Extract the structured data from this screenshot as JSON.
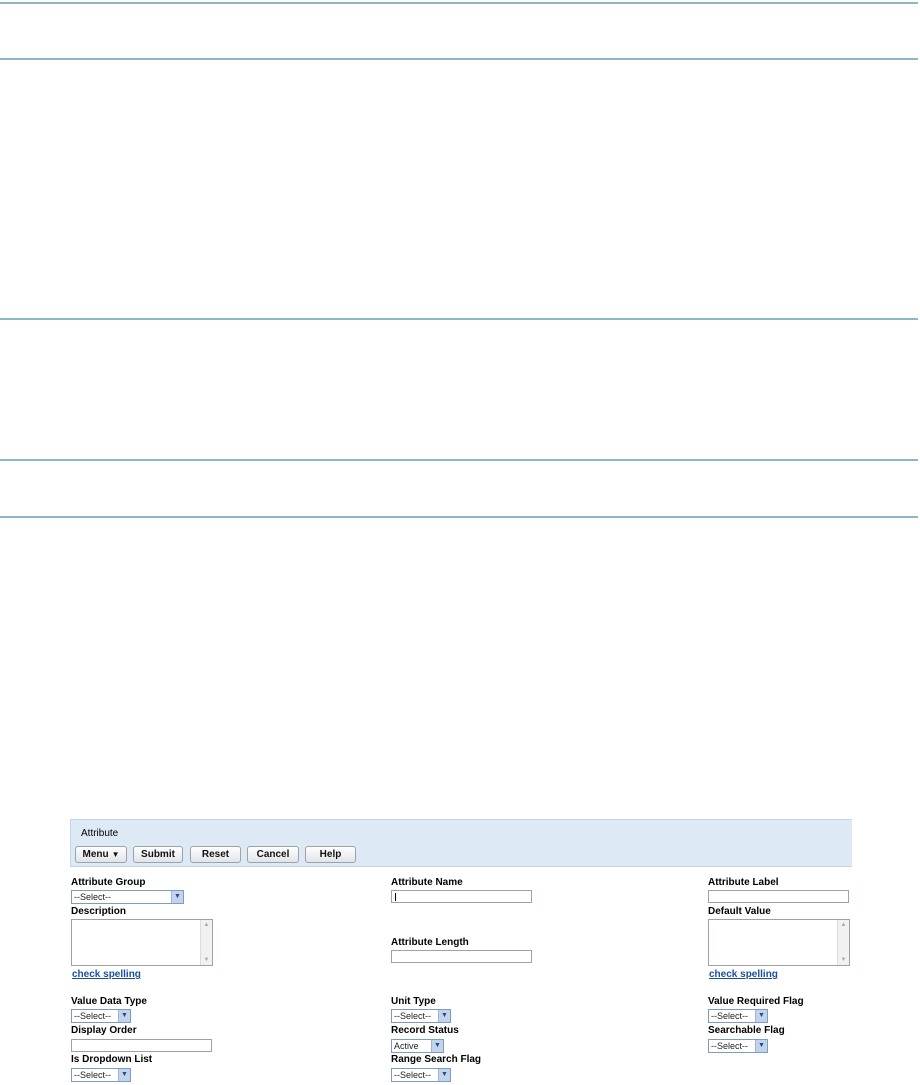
{
  "header": {
    "title": "Attribute"
  },
  "toolbar": {
    "menu_label": "Menu",
    "submit_label": "Submit",
    "reset_label": "Reset",
    "cancel_label": "Cancel",
    "help_label": "Help"
  },
  "fields": {
    "attribute_group": {
      "label": "Attribute Group",
      "value": "--Select--"
    },
    "attribute_name": {
      "label": "Attribute Name",
      "value": ""
    },
    "attribute_label": {
      "label": "Attribute Label",
      "value": ""
    },
    "description": {
      "label": "Description",
      "value": ""
    },
    "default_value": {
      "label": "Default Value",
      "value": ""
    },
    "attribute_length": {
      "label": "Attribute Length",
      "value": ""
    },
    "value_data_type": {
      "label": "Value Data Type",
      "value": "--Select--"
    },
    "unit_type": {
      "label": "Unit Type",
      "value": "--Select--"
    },
    "value_required_flag": {
      "label": "Value Required Flag",
      "value": "--Select--"
    },
    "display_order": {
      "label": "Display Order",
      "value": ""
    },
    "record_status": {
      "label": "Record Status",
      "value": "Active"
    },
    "searchable_flag": {
      "label": "Searchable Flag",
      "value": "--Select--"
    },
    "is_dropdown_list": {
      "label": "Is Dropdown List",
      "value": "--Select--"
    },
    "range_search_flag": {
      "label": "Range Search Flag",
      "value": "--Select--"
    }
  },
  "links": {
    "check_spelling": "check spelling"
  }
}
